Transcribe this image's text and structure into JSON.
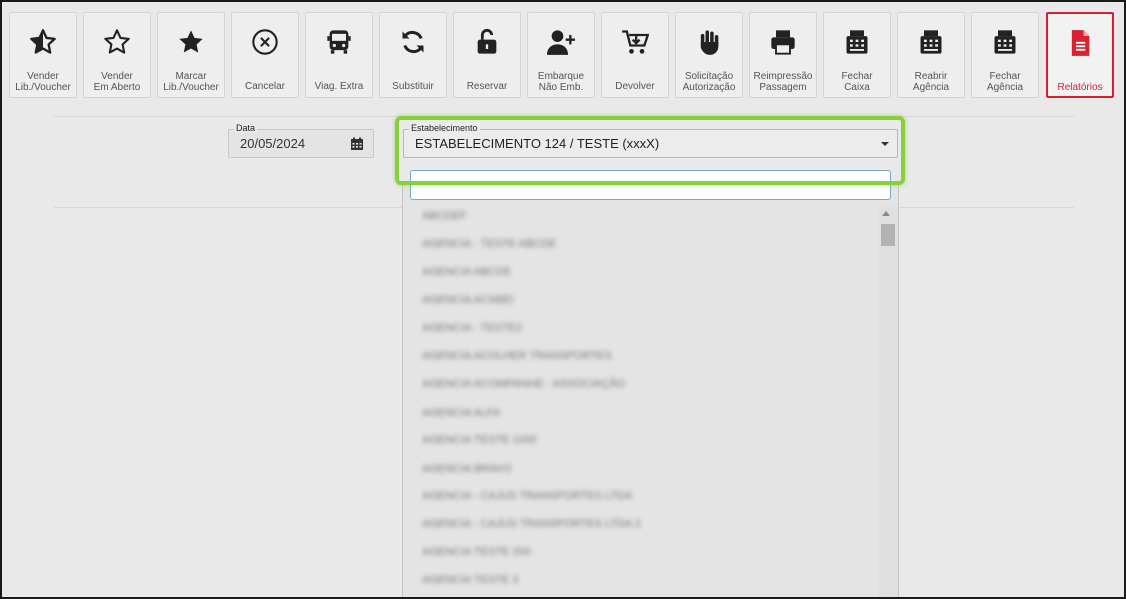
{
  "toolbar": {
    "buttons": [
      {
        "label": "Vender\nLib./Voucher",
        "icon": "star-half-icon"
      },
      {
        "label": "Vender\nEm Aberto",
        "icon": "star-outline-icon"
      },
      {
        "label": "Marcar\nLib./Voucher",
        "icon": "star-filled-icon"
      },
      {
        "label": "Cancelar",
        "icon": "cancel-circle-icon"
      },
      {
        "label": "Viag. Extra",
        "icon": "bus-icon"
      },
      {
        "label": "Substituir",
        "icon": "refresh-icon"
      },
      {
        "label": "Reservar",
        "icon": "unlock-icon"
      },
      {
        "label": "Embarque\nNão Emb.",
        "icon": "user-plus-icon"
      },
      {
        "label": "Devolver",
        "icon": "cart-return-icon"
      },
      {
        "label": "Solicitação\nAutorização",
        "icon": "hand-icon"
      },
      {
        "label": "Reimpressão\nPassagem",
        "icon": "printer-icon"
      },
      {
        "label": "Fechar\nCaixa",
        "icon": "cash-register-icon"
      },
      {
        "label": "Reabrir\nAgência",
        "icon": "cash-register-icon"
      },
      {
        "label": "Fechar\nAgência",
        "icon": "cash-register-icon"
      },
      {
        "label": "Relatórios",
        "icon": "report-file-icon"
      }
    ],
    "active": "Relatórios",
    "active_color": "#d8202e"
  },
  "filters": {
    "date_label": "Data",
    "date_value": "20/05/2024",
    "establishment_label": "Estabelecimento",
    "establishment_value": "ESTABELECIMENTO 124 / TESTE (xxxX)",
    "search_value": ""
  },
  "highlight_color": "#88cf3c"
}
